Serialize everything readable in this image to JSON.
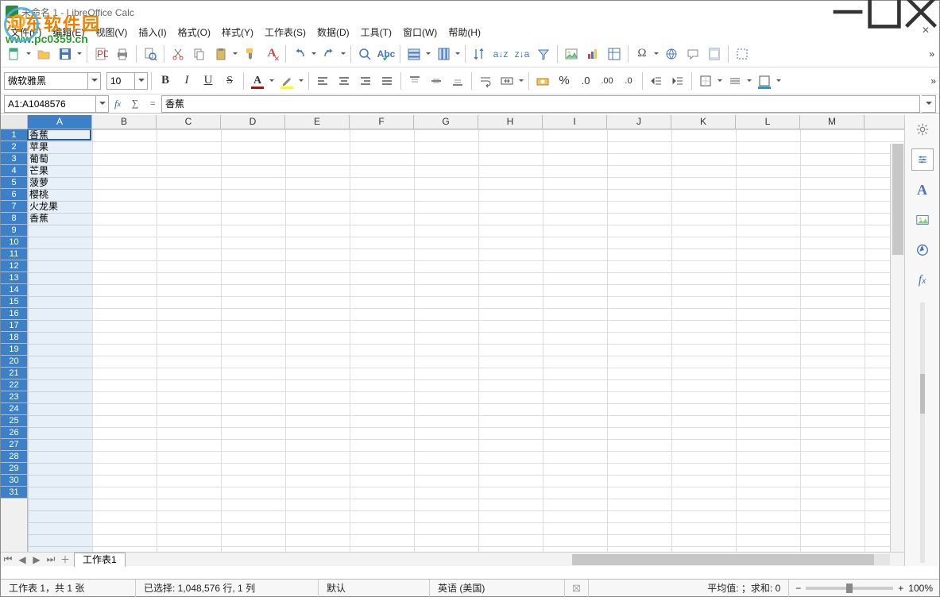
{
  "window": {
    "title": "未命名 1 - LibreOffice Calc"
  },
  "watermark": {
    "line1": "河东软件园",
    "line2": "www.pc0359.cn"
  },
  "menu": {
    "file": "文件(F)",
    "edit": "编辑(E)",
    "view": "视图(V)",
    "insert": "插入(I)",
    "format": "格式(O)",
    "style": "样式(Y)",
    "sheet": "工作表(S)",
    "data": "数据(D)",
    "tools": "工具(T)",
    "window": "窗口(W)",
    "help": "帮助(H)"
  },
  "format": {
    "font": "微软雅黑",
    "size": "10"
  },
  "ref": {
    "namebox": "A1:A1048576",
    "formula": "香蕉"
  },
  "columns": [
    "A",
    "B",
    "C",
    "D",
    "E",
    "F",
    "G",
    "H",
    "I",
    "J",
    "K",
    "L",
    "M"
  ],
  "selected_col": "A",
  "rows": 31,
  "cellsA": [
    "香蕉",
    "苹果",
    "葡萄",
    "芒果",
    "菠萝",
    "樱桃",
    "火龙果",
    "香蕉"
  ],
  "tabs": {
    "sheet1": "工作表1"
  },
  "status": {
    "sheets": "工作表 1，共 1 张",
    "selection": "已选择: 1,048,576 行, 1 列",
    "insmode": "默认",
    "lang": "英语 (美国)",
    "stats": "平均值: ；求和: 0",
    "zoom": "100%"
  },
  "sidebar_icons": [
    "gear-icon",
    "properties-icon",
    "styles-icon",
    "gallery-icon",
    "navigator-icon",
    "functions-icon"
  ]
}
